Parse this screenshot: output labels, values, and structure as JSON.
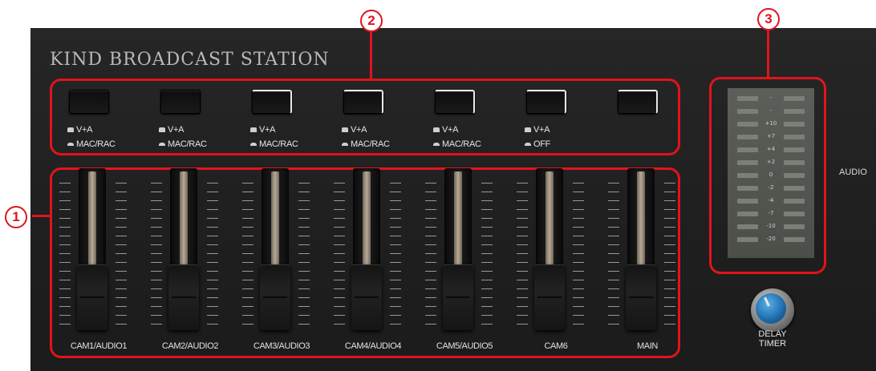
{
  "station_title": "KIND BROADCAST STATION",
  "callouts": {
    "one": "1",
    "two": "2",
    "three": "3"
  },
  "buttons": [
    {
      "top_label": "V+A",
      "bottom_label": "MAC/RAC",
      "lit": false
    },
    {
      "top_label": "V+A",
      "bottom_label": "MAC/RAC",
      "lit": false
    },
    {
      "top_label": "V+A",
      "bottom_label": "MAC/RAC",
      "lit": true
    },
    {
      "top_label": "V+A",
      "bottom_label": "MAC/RAC",
      "lit": true
    },
    {
      "top_label": "V+A",
      "bottom_label": "MAC/RAC",
      "lit": true
    },
    {
      "top_label": "V+A",
      "bottom_label": "OFF",
      "lit": true
    },
    {
      "lit": true
    }
  ],
  "faders": [
    {
      "label": "CAM1/AUDIO1"
    },
    {
      "label": "CAM2/AUDIO2"
    },
    {
      "label": "CAM3/AUDIO3"
    },
    {
      "label": "CAM4/AUDIO4"
    },
    {
      "label": "CAM5/AUDIO5"
    },
    {
      "label": "CAM6"
    },
    {
      "label": "MAIN"
    }
  ],
  "meter": {
    "scale": [
      "-",
      "-",
      "+10",
      "+7",
      "+4",
      "+2",
      "0",
      "-2",
      "-4",
      "-7",
      "-10",
      "-20"
    ]
  },
  "side_label": "AUDIO",
  "delay_timer": {
    "line1": "DELAY",
    "line2": "TIMER"
  },
  "colors": {
    "callout": "#e0141c",
    "panel": "#222222",
    "knob_accent": "#1b6aa9"
  }
}
